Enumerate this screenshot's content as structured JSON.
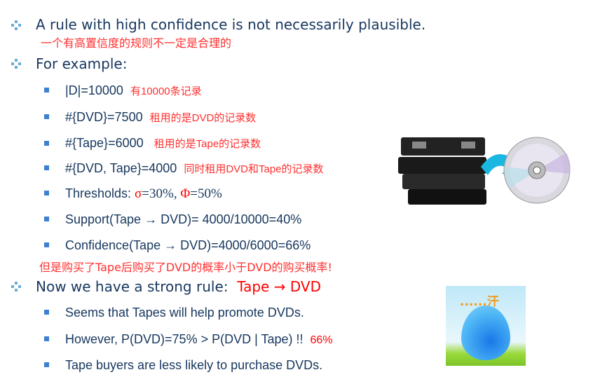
{
  "bullets": [
    {
      "text": "A rule with high confidence is not necessarily plausible.",
      "note": "一个有高置信度的规则不一定是合理的"
    },
    {
      "text": "For example:"
    },
    {
      "text": "Now we have a strong rule:",
      "highlight": "Tape → DVD"
    }
  ],
  "example": [
    {
      "text": "|D|=10000",
      "note": "有10000条记录"
    },
    {
      "text": "#{DVD}=7500",
      "note": "租用的是DVD的记录数"
    },
    {
      "text": "#{Tape}=6000",
      "note": "租用的是Tape的记录数"
    },
    {
      "text": "#{DVD, Tape}=4000",
      "note": "同时租用DVD和Tape的记录数"
    },
    {
      "label": "Thresholds: ",
      "sigma": "σ",
      "sigma_val": "=30%, ",
      "phi": "Φ",
      "phi_val": "=50%"
    },
    {
      "text": "Support(Tape → DVD)= 4000/10000=40%"
    },
    {
      "text": "Confidence(Tape → DVD)=4000/6000=66%"
    }
  ],
  "example_note": "但是购买了Tape后购买了DVD的概率小于DVD的购买概率!",
  "rule_points": [
    {
      "text": "Seems that Tapes will help promote DVDs."
    },
    {
      "text": "However, P(DVD)=75% > P(DVD | Tape) !!",
      "note": "66%"
    },
    {
      "text": "Tape buyers are less likely to purchase DVDs."
    }
  ],
  "emoji": {
    "caption": "......汗"
  }
}
